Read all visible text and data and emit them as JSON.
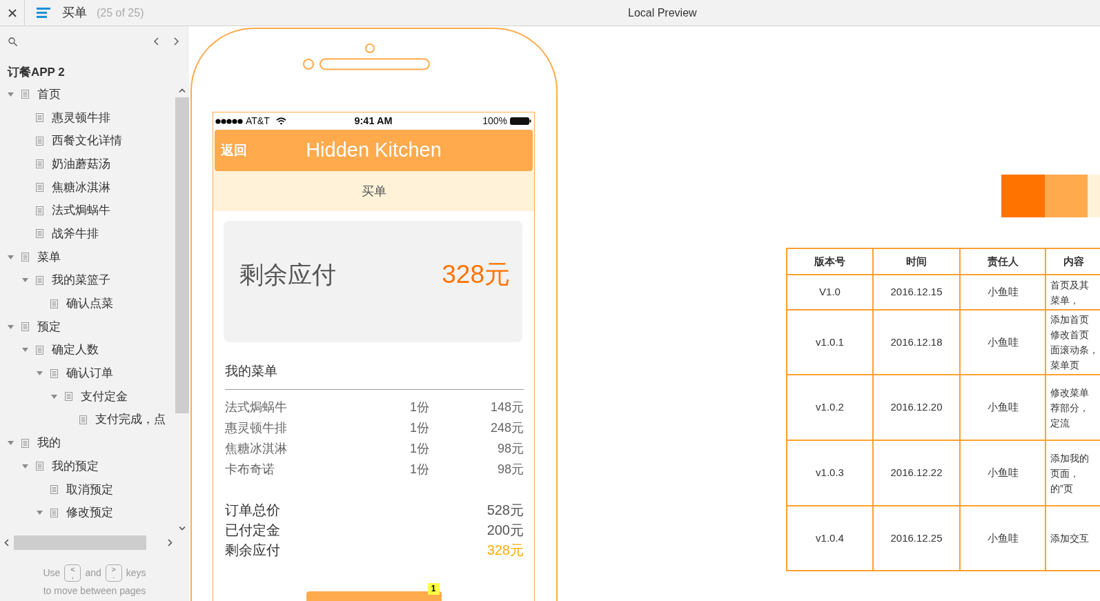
{
  "toolbar": {
    "title": "买单",
    "page_count": "(25 of 25)",
    "preview_label": "Local Preview"
  },
  "sidebar": {
    "project_title": "订餐APP 2",
    "tree": [
      {
        "label": "首页",
        "expanded": true,
        "children": [
          {
            "label": "惠灵顿牛排"
          },
          {
            "label": "西餐文化详情"
          },
          {
            "label": "奶油蘑菇汤"
          },
          {
            "label": "焦糖冰淇淋"
          },
          {
            "label": "法式焗蜗牛"
          },
          {
            "label": "战斧牛排"
          }
        ]
      },
      {
        "label": "菜单",
        "expanded": true,
        "children": [
          {
            "label": "我的菜篮子",
            "expanded": true,
            "children": [
              {
                "label": "确认点菜"
              }
            ]
          }
        ]
      },
      {
        "label": "预定",
        "expanded": true,
        "children": [
          {
            "label": "确定人数",
            "expanded": true,
            "children": [
              {
                "label": "确认订单",
                "expanded": true,
                "children": [
                  {
                    "label": "支付定金",
                    "expanded": true,
                    "children": [
                      {
                        "label": "支付完成，点"
                      }
                    ]
                  }
                ]
              }
            ]
          }
        ]
      },
      {
        "label": "我的",
        "expanded": true,
        "children": [
          {
            "label": "我的预定",
            "expanded": true,
            "children": [
              {
                "label": "取消预定"
              },
              {
                "label": "修改预定",
                "expanded": true
              }
            ]
          }
        ]
      }
    ],
    "hint": {
      "line1": [
        {
          "kind": "text",
          "text": "Use"
        },
        {
          "kind": "key",
          "upper": "<",
          "lower": ","
        },
        {
          "kind": "text",
          "text": "and"
        },
        {
          "kind": "key",
          "upper": ">",
          "lower": "."
        },
        {
          "kind": "text",
          "text": "keys"
        }
      ],
      "line2": "to move between pages"
    }
  },
  "phone": {
    "status_bar": {
      "carrier": "AT&T",
      "time": "9:41 AM",
      "battery": "100%"
    },
    "nav_bar": {
      "back": "返回",
      "title": "Hidden Kitchen"
    },
    "page_title": "买单",
    "due_card": {
      "label": "剩余应付",
      "amount": "328元"
    },
    "menu": {
      "heading": "我的菜单",
      "items": [
        {
          "name": "法式焗蜗牛",
          "qty": "1份",
          "price": "148元"
        },
        {
          "name": "惠灵顿牛排",
          "qty": "1份",
          "price": "248元"
        },
        {
          "name": "焦糖冰淇淋",
          "qty": "1份",
          "price": "98元"
        },
        {
          "name": "卡布奇诺",
          "qty": "1份",
          "price": "98元"
        }
      ]
    },
    "totals": [
      {
        "label": "订单总价",
        "value": "528元",
        "color": "#555555"
      },
      {
        "label": "已付定金",
        "value": "200元",
        "color": "#555555"
      },
      {
        "label": "剩余应付",
        "value": "328元",
        "color": "#ffad00"
      }
    ],
    "pay_button": {
      "badge": "1"
    }
  },
  "swatches": [
    {
      "color": "#ff7300"
    },
    {
      "color": "#ffaa4d"
    },
    {
      "color": "#fff2d9"
    }
  ],
  "version_table": {
    "columns": [
      "版本号",
      "时间",
      "责任人",
      "内容"
    ],
    "rows": [
      {
        "version": "V1.0",
        "date": "2016.12.15",
        "owner": "小鱼哇",
        "content": [
          "首页及其",
          "菜单，"
        ]
      },
      {
        "version": "v1.0.1",
        "date": "2016.12.18",
        "owner": "小鱼哇",
        "content": [
          "添加首页",
          "修改首页",
          "面滚动条，",
          "菜单页"
        ]
      },
      {
        "version": "v1.0.2",
        "date": "2016.12.20",
        "owner": "小鱼哇",
        "content": [
          "修改菜单",
          "荐部分，",
          "定流"
        ]
      },
      {
        "version": "v1.0.3",
        "date": "2016.12.22",
        "owner": "小鱼哇",
        "content": [
          "添加我的",
          "页面，",
          "的”页"
        ]
      },
      {
        "version": "v1.0.4",
        "date": "2016.12.25",
        "owner": "小鱼哇",
        "content": [
          "添加交互"
        ]
      }
    ]
  }
}
